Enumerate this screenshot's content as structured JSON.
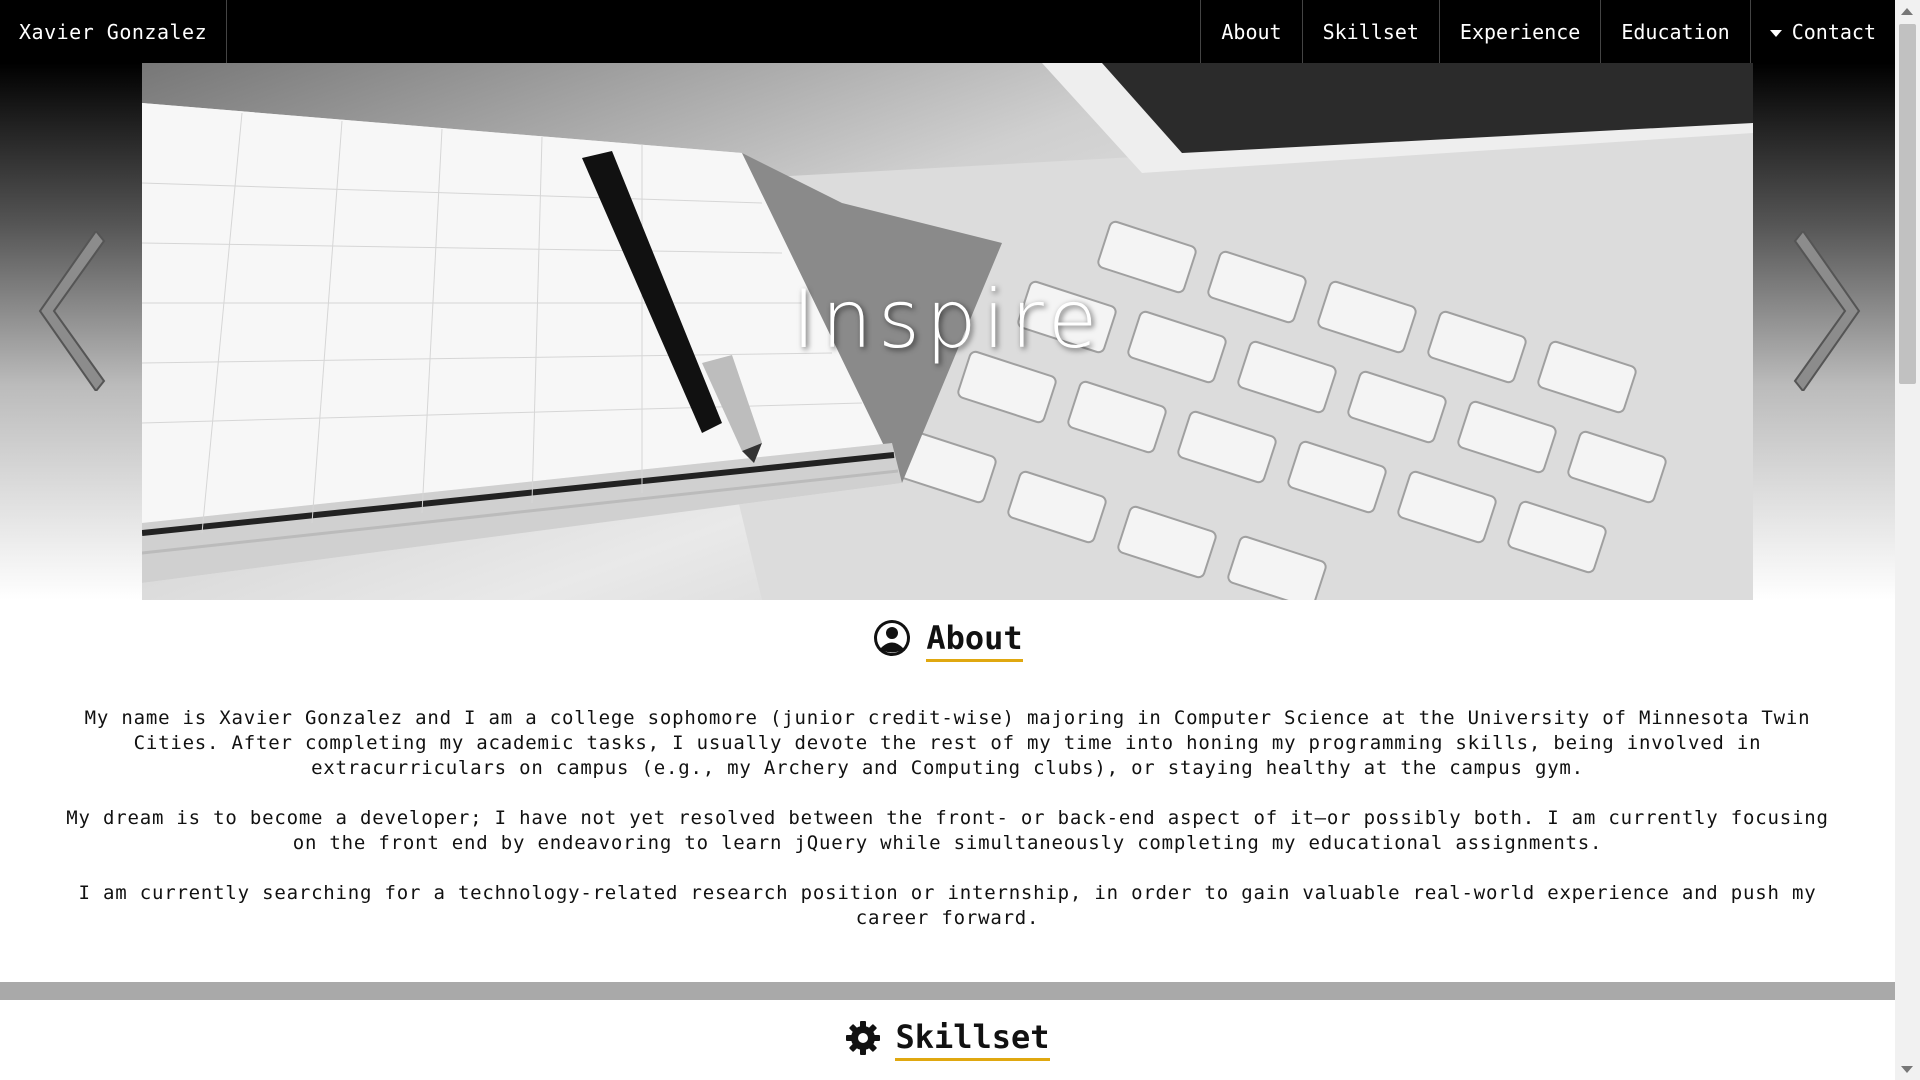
{
  "navbar": {
    "brand": "Xavier Gonzalez",
    "items": [
      {
        "label": "About"
      },
      {
        "label": "Skillset"
      },
      {
        "label": "Experience"
      },
      {
        "label": "Education"
      },
      {
        "label": "Contact"
      }
    ]
  },
  "hero": {
    "caption": "Inspire"
  },
  "about": {
    "title": "About",
    "paragraphs": [
      "My name is Xavier Gonzalez and I am a college sophomore (junior credit-wise) majoring in Computer Science at the University of Minnesota Twin Cities. After completing my academic tasks, I usually devote the rest of my time into honing my programming skills, being involved in extracurriculars on campus (e.g., my Archery and Computing clubs), or staying healthy at the campus gym.",
      "My dream is to become a developer; I have not yet resolved between the front- or back-end aspect of it—or possibly both. I am currently focusing on the front end by endeavoring to learn jQuery while simultaneously completing my educational assignments.",
      "I am currently searching for a technology-related research position or internship, in order to gain valuable real-world experience and push my career forward."
    ]
  },
  "skillset": {
    "title": "Skillset"
  },
  "colors": {
    "accent_underline": "#e0a810",
    "navbar_bg": "#000000",
    "divider": "#a9a9a9"
  }
}
